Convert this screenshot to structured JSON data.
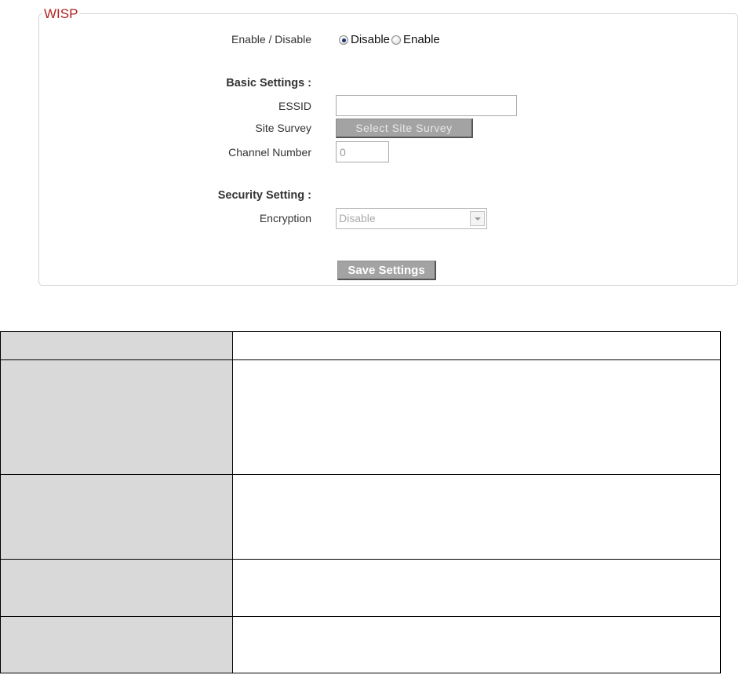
{
  "wisp": {
    "legend": "WISP",
    "enable_label": "Enable / Disable",
    "radio_options": [
      {
        "label": "Disable",
        "checked": true
      },
      {
        "label": "Enable",
        "checked": false
      }
    ],
    "basic_settings_label": "Basic Settings :",
    "essid_label": "ESSID",
    "essid_value": "",
    "site_survey_label": "Site Survey",
    "site_survey_button": "Select Site Survey",
    "channel_label": "Channel Number",
    "channel_value": "0",
    "security_setting_label": "Security Setting :",
    "encryption_label": "Encryption",
    "encryption_value": "Disable",
    "save_button": "Save Settings",
    "colors": {
      "legend": "#b22222",
      "button_bg": "#a3a3a3",
      "panel_border": "#d3d3d3"
    },
    "icons": {
      "radio": "radio-icon",
      "dropdown": "chevron-down-icon"
    }
  },
  "table": {
    "rows": [
      {
        "key": "",
        "value": ""
      },
      {
        "key": "",
        "value": ""
      },
      {
        "key": "",
        "value": ""
      },
      {
        "key": "",
        "value": ""
      },
      {
        "key": "",
        "value": ""
      }
    ],
    "colors": {
      "key_bg": "#d9d9d9",
      "border": "#000000"
    }
  }
}
